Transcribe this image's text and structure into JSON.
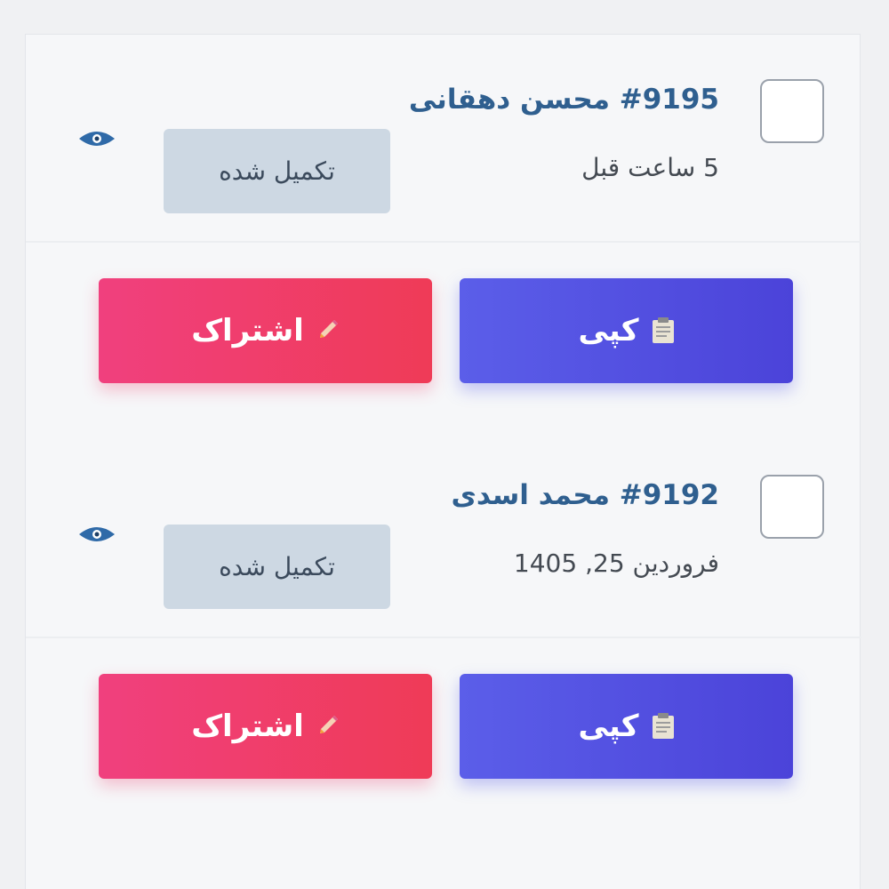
{
  "orders": [
    {
      "title": "#9195 محسن دهقانی",
      "time": "5 ساعت قبل",
      "status": "تکمیل شده",
      "copy_label": "کپی",
      "share_label": "اشتراک"
    },
    {
      "title": "#9192 محمد اسدی",
      "time": "فروردین 25, 1405",
      "status": "تکمیل شده",
      "copy_label": "کپی",
      "share_label": "اشتراک"
    }
  ],
  "colors": {
    "title": "#2f5f8f",
    "status_bg": "#cdd8e3",
    "copy_button": "#5258e4",
    "share_button": "#ef3d6a"
  },
  "icons": {
    "view": "eye-icon",
    "copy": "clipboard-icon",
    "share": "pencil-icon"
  }
}
